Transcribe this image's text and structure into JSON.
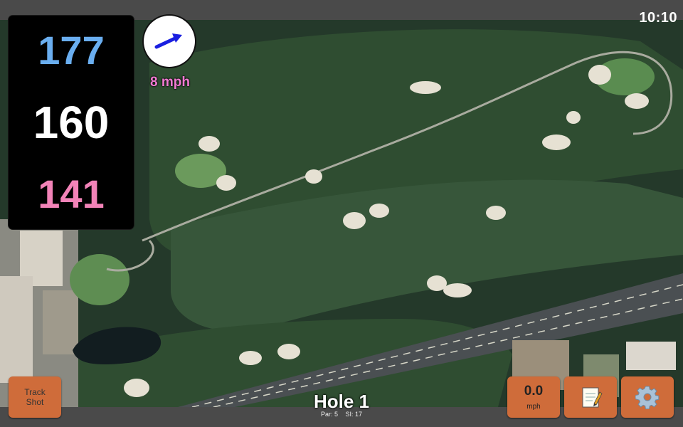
{
  "status_bar": {
    "time": "10:10"
  },
  "distances": {
    "back": "177",
    "middle": "160",
    "front": "141"
  },
  "wind": {
    "speed": "8 mph"
  },
  "hole": {
    "title": "Hole 1",
    "par": "Par: 5",
    "stroke_index": "SI: 17"
  },
  "buttons": {
    "track_shot_line1": "Track",
    "track_shot_line2": "Shot",
    "speed_value": "0.0",
    "speed_unit": "mph"
  },
  "icons": {
    "wind": "arrow-icon",
    "notes": "notepad-icon",
    "settings": "gear-icon"
  },
  "colors": {
    "back_distance": "#6aaef0",
    "middle_distance": "#ffffff",
    "front_distance": "#f283b8",
    "wind_text": "#f27ad2",
    "button": "#cf6c3a"
  }
}
